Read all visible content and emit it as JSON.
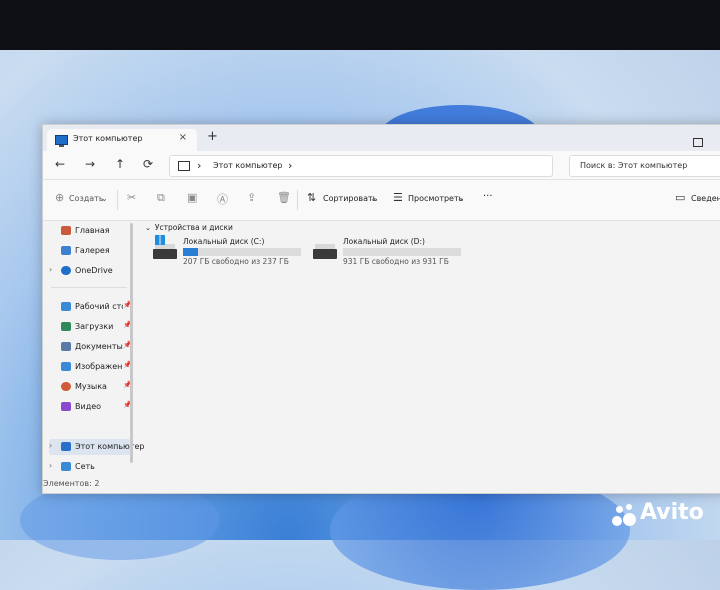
{
  "window": {
    "tab_title": "Этот компьютер",
    "tab_close": "×",
    "new_tab": "+"
  },
  "nav": {
    "back": "←",
    "forward": "→",
    "up": "↑",
    "refresh": "⟳",
    "address_crumb": "Этот компьютер",
    "address_sep": "›",
    "search_placeholder": "Поиск в: Этот компьютер"
  },
  "toolbar": {
    "create_label": "Создать",
    "sort_label": "Сортировать",
    "view_label": "Просмотреть",
    "more_label": "···",
    "details_label": "Сведени"
  },
  "sidebar": {
    "items": [
      {
        "label": "Главная",
        "icon": "home-icon",
        "color": "#c95a3a"
      },
      {
        "label": "Галерея",
        "icon": "gallery-icon",
        "color": "#3d7fd0"
      },
      {
        "label": "OneDrive",
        "icon": "cloud-icon",
        "color": "#1f6fc8"
      },
      {
        "label": "Рабочий сто",
        "icon": "desktop-icon",
        "color": "#3a8ad8"
      },
      {
        "label": "Загрузки",
        "icon": "download-icon",
        "color": "#2f8a5a"
      },
      {
        "label": "Документы",
        "icon": "documents-icon",
        "color": "#5a7aa8"
      },
      {
        "label": "Изображен",
        "icon": "pictures-icon",
        "color": "#3a8ad8"
      },
      {
        "label": "Музыка",
        "icon": "music-icon",
        "color": "#d05a3a"
      },
      {
        "label": "Видео",
        "icon": "video-icon",
        "color": "#8a4ad0"
      },
      {
        "label": "Этот компьютер",
        "icon": "computer-icon",
        "color": "#2a6fc8"
      },
      {
        "label": "Сеть",
        "icon": "network-icon",
        "color": "#3a8ad8"
      }
    ]
  },
  "content": {
    "group_header": "Устройства и диски",
    "drives": [
      {
        "name": "Локальный диск (C:)",
        "free": "207 ГБ свободно из 237 ГБ",
        "used_fraction": 0.13
      },
      {
        "name": "Локальный диск (D:)",
        "free": "931 ГБ свободно из 931 ГБ",
        "used_fraction": 0.0
      }
    ]
  },
  "status": {
    "items_count": "Элементов: 2"
  },
  "watermark": {
    "text": "Avito"
  }
}
